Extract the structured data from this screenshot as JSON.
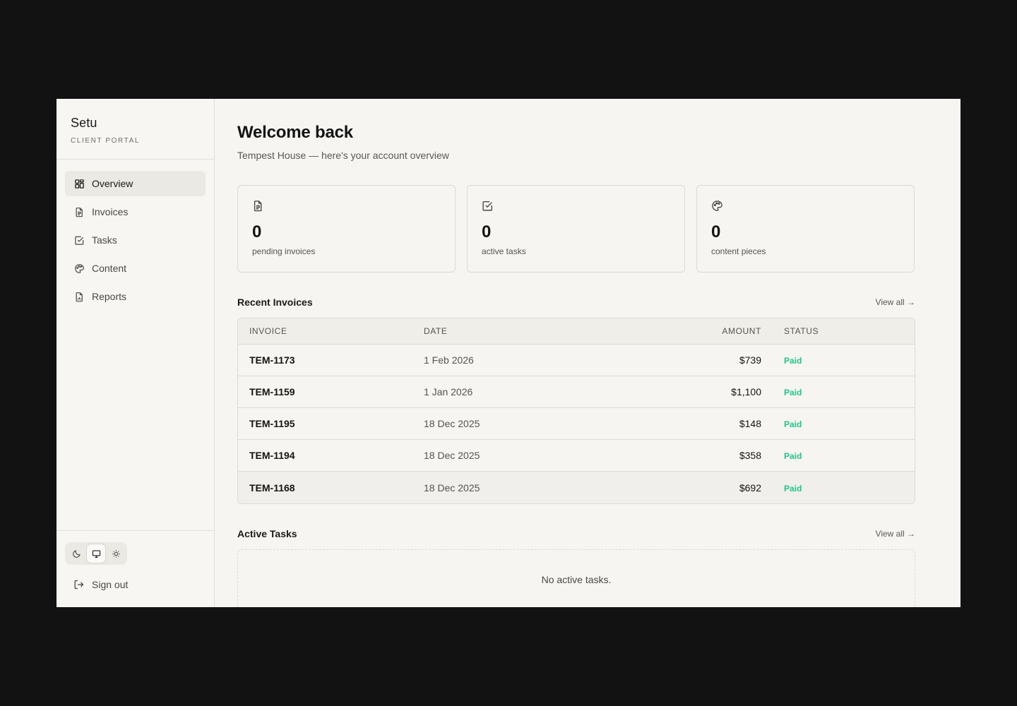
{
  "brand": {
    "name": "Setu",
    "subtitle": "CLIENT PORTAL"
  },
  "nav": [
    {
      "label": "Overview",
      "icon": "grid-icon",
      "active": true
    },
    {
      "label": "Invoices",
      "icon": "file-text-icon",
      "active": false
    },
    {
      "label": "Tasks",
      "icon": "check-square-icon",
      "active": false
    },
    {
      "label": "Content",
      "icon": "palette-icon",
      "active": false
    },
    {
      "label": "Reports",
      "icon": "file-chart-icon",
      "active": false
    }
  ],
  "theme": {
    "options": [
      "moon-icon",
      "monitor-icon",
      "sun-icon"
    ],
    "selected": "monitor-icon"
  },
  "signout": {
    "label": "Sign out"
  },
  "header": {
    "title": "Welcome back",
    "subtitle": "Tempest House — here's your account overview"
  },
  "stats": [
    {
      "value": "0",
      "label": "pending invoices",
      "icon": "file-text-icon"
    },
    {
      "value": "0",
      "label": "active tasks",
      "icon": "check-square-icon"
    },
    {
      "value": "0",
      "label": "content pieces",
      "icon": "palette-icon"
    }
  ],
  "invoices": {
    "title": "Recent Invoices",
    "view_all": "View all →",
    "columns": [
      "INVOICE",
      "DATE",
      "AMOUNT",
      "STATUS"
    ],
    "rows": [
      {
        "invoice": "TEM-1173",
        "date": "1 Feb 2026",
        "amount": "$739",
        "status": "Paid"
      },
      {
        "invoice": "TEM-1159",
        "date": "1 Jan 2026",
        "amount": "$1,100",
        "status": "Paid"
      },
      {
        "invoice": "TEM-1195",
        "date": "18 Dec 2025",
        "amount": "$148",
        "status": "Paid"
      },
      {
        "invoice": "TEM-1194",
        "date": "18 Dec 2025",
        "amount": "$358",
        "status": "Paid"
      },
      {
        "invoice": "TEM-1168",
        "date": "18 Dec 2025",
        "amount": "$692",
        "status": "Paid"
      }
    ]
  },
  "tasks": {
    "title": "Active Tasks",
    "view_all": "View all →",
    "empty": "No active tasks."
  },
  "colors": {
    "accent_paid": "#22c48a",
    "background": "#f6f5f1",
    "frame": "#121212"
  }
}
